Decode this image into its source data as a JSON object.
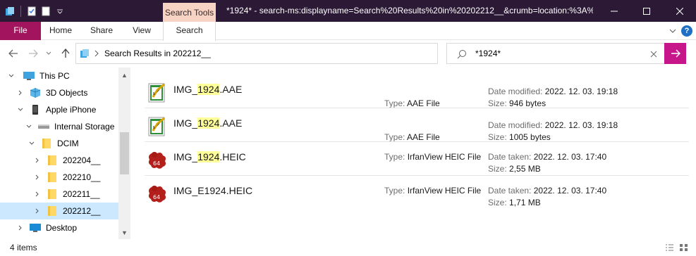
{
  "title_bar": {
    "context_tab": "Search Tools",
    "window_title": "*1924* - search-ms:displayname=Search%20Results%20in%20202212__&crumb=location:%3A%..."
  },
  "ribbon": {
    "file": "File",
    "tabs": [
      "Home",
      "Share",
      "View",
      "Search"
    ]
  },
  "address": {
    "path": "Search Results in 202212__"
  },
  "search": {
    "value": "*1924*"
  },
  "nav_tree": [
    {
      "label": "This PC",
      "icon": "pc-icon"
    },
    {
      "label": "3D Objects",
      "icon": "3d-objects-icon"
    },
    {
      "label": "Apple iPhone",
      "icon": "phone-icon"
    },
    {
      "label": "Internal Storage",
      "icon": "drive-icon"
    },
    {
      "label": "DCIM",
      "icon": "folder-icon"
    },
    {
      "label": "202204__",
      "icon": "folder-icon"
    },
    {
      "label": "202210__",
      "icon": "folder-icon"
    },
    {
      "label": "202211__",
      "icon": "folder-icon"
    },
    {
      "label": "202212__",
      "icon": "folder-icon"
    },
    {
      "label": "Desktop",
      "icon": "desktop-icon"
    }
  ],
  "files": [
    {
      "name_pre": "IMG_",
      "name_hl": "1924",
      "name_post": ".AAE",
      "icon": "aae-file-icon",
      "type_label": "Type:",
      "type_value": "AAE File",
      "meta1_label": "Date modified:",
      "meta1_value": "2022. 12. 03. 19:18",
      "meta2_label": "Size:",
      "meta2_value": "946 bytes"
    },
    {
      "name_pre": "IMG_",
      "name_hl": "1924",
      "name_post": ".AAE",
      "icon": "aae-file-icon",
      "type_label": "Type:",
      "type_value": "AAE File",
      "meta1_label": "Date modified:",
      "meta1_value": "2022. 12. 03. 19:18",
      "meta2_label": "Size:",
      "meta2_value": "1005 bytes"
    },
    {
      "name_pre": "IMG_",
      "name_hl": "1924",
      "name_post": ".HEIC",
      "icon": "irfanview-heic-icon",
      "type_label": "Type:",
      "type_value": "IrfanView HEIC File",
      "meta1_label": "Date taken:",
      "meta1_value": "2022. 12. 03. 17:40",
      "meta2_label": "Size:",
      "meta2_value": "2,55 MB"
    },
    {
      "name_pre": "IMG_E1924.HEIC",
      "name_hl": "",
      "name_post": "",
      "icon": "irfanview-heic-icon",
      "type_label": "Type:",
      "type_value": "IrfanView HEIC File",
      "meta1_label": "Date taken:",
      "meta1_value": "2022. 12. 03. 17:40",
      "meta2_label": "Size:",
      "meta2_value": "1,71 MB"
    }
  ],
  "status": {
    "items": "4 items"
  },
  "colors": {
    "titlebar": "#2b1935",
    "file_tab": "#a2155e",
    "search_tools_tab": "#f6d3c2",
    "search_go": "#c7158a",
    "selection": "#cce8ff",
    "highlight": "#ffff99"
  }
}
